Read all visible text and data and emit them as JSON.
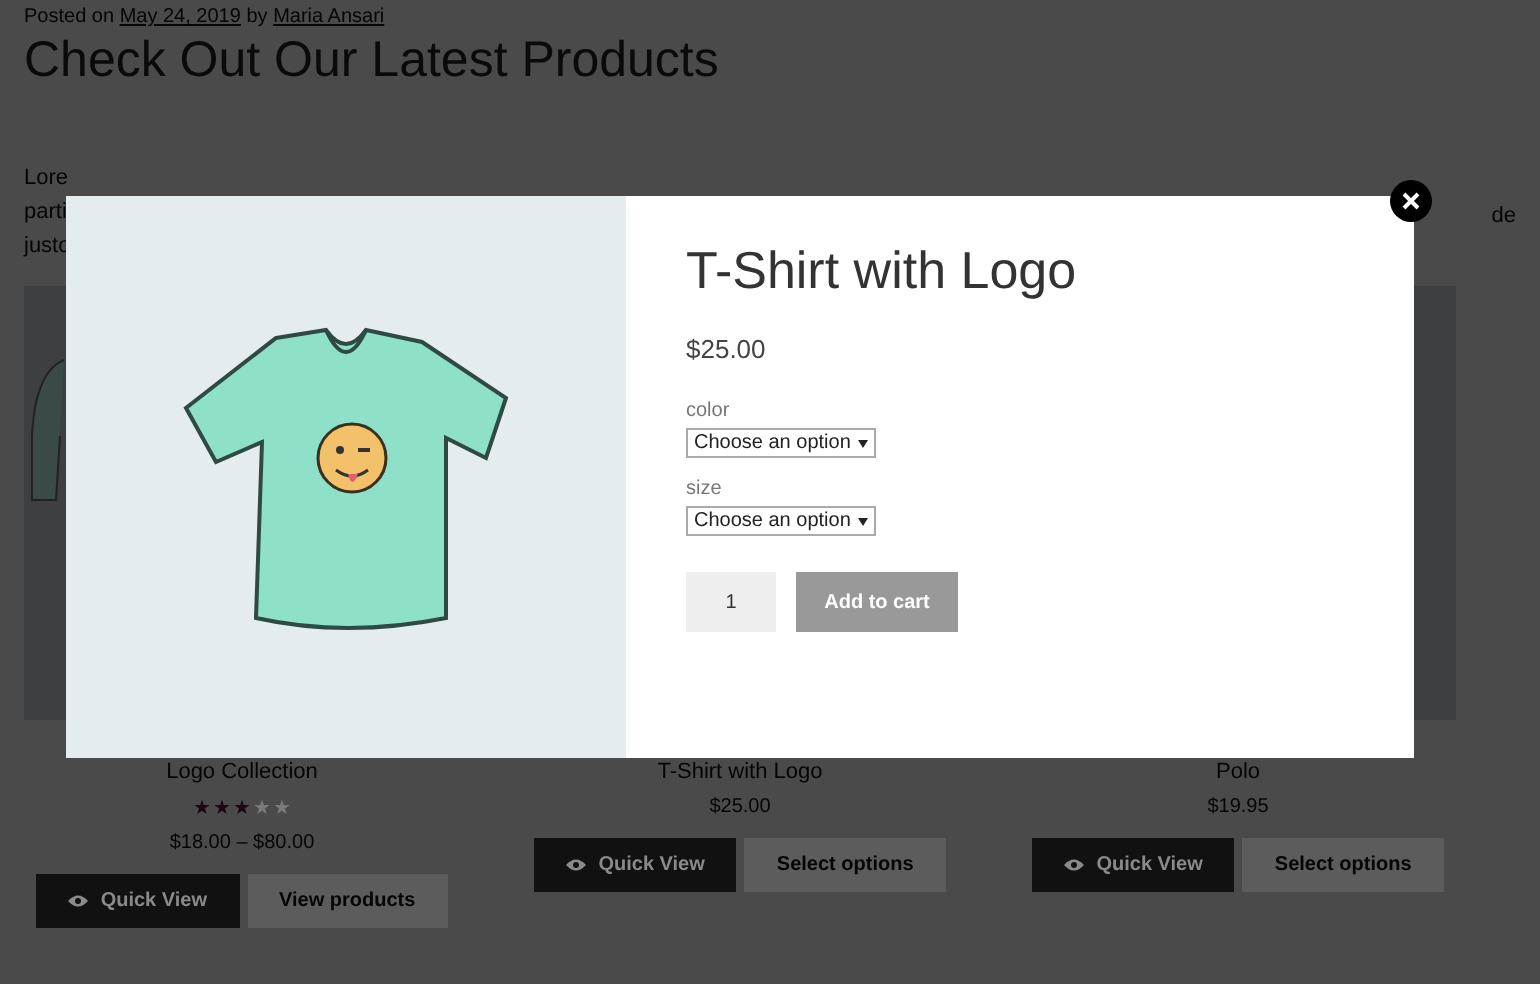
{
  "post_meta": {
    "prefix": "Posted on",
    "date": "May 24, 2019",
    "by": "by",
    "author": "Maria Ansari"
  },
  "page_title": "Check Out Our Latest Products",
  "paragraph_fragments_left": [
    "Lore",
    "parti",
    "justo"
  ],
  "paragraph_fragment_right": "de",
  "products": [
    {
      "name": "Logo Collection",
      "stars": 3,
      "price": "$18.00 – $80.00",
      "buttons": [
        {
          "label": "Quick View",
          "kind": "quick"
        },
        {
          "label": "View products",
          "kind": "plain"
        }
      ]
    },
    {
      "name": "T-Shirt with Logo",
      "price": "$25.00",
      "buttons": [
        {
          "label": "Quick View",
          "kind": "quick"
        },
        {
          "label": "Select options",
          "kind": "plain"
        }
      ]
    },
    {
      "name": "Polo",
      "price": "$19.95",
      "buttons": [
        {
          "label": "Quick View",
          "kind": "quick"
        },
        {
          "label": "Select options",
          "kind": "plain"
        }
      ]
    }
  ],
  "quick_view": {
    "title": "T-Shirt with Logo",
    "price": "$25.00",
    "attributes": [
      {
        "label": "color",
        "value": "Choose an option"
      },
      {
        "label": "size",
        "value": "Choose an option"
      }
    ],
    "quantity": "1",
    "add_to_cart": "Add to cart"
  }
}
